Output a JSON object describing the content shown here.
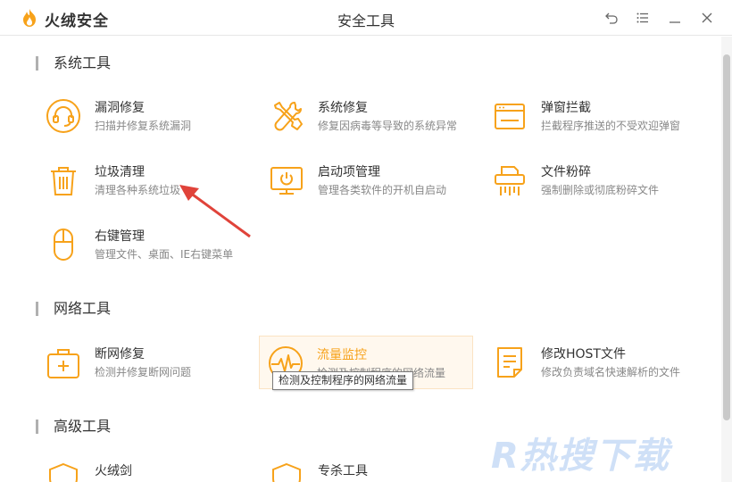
{
  "app": {
    "brand": "火绒安全",
    "window_title": "安全工具",
    "buttons": [
      "back-icon",
      "menu-icon",
      "minimize-icon",
      "close-icon"
    ]
  },
  "colors": {
    "accent": "#f7a21a",
    "text": "#333333",
    "muted": "#888888",
    "arrow": "#e0433a"
  },
  "sections": {
    "system": {
      "title": "系统工具"
    },
    "network": {
      "title": "网络工具"
    },
    "advanced": {
      "title": "高级工具"
    }
  },
  "tools": {
    "vuln_fix": {
      "name": "漏洞修复",
      "desc": "扫描并修复系统漏洞",
      "icon": "headset-icon"
    },
    "system_fix": {
      "name": "系统修复",
      "desc": "修复因病毒等导致的系统异常",
      "icon": "wrench-icon"
    },
    "popup_block": {
      "name": "弹窗拦截",
      "desc": "拦截程序推送的不受欢迎弹窗",
      "icon": "window-icon"
    },
    "junk_clean": {
      "name": "垃圾清理",
      "desc": "清理各种系统垃圾",
      "icon": "trash-icon"
    },
    "startup_mgr": {
      "name": "启动项管理",
      "desc": "管理各类软件的开机自启动",
      "icon": "monitor-icon"
    },
    "file_shred": {
      "name": "文件粉碎",
      "desc": "强制删除或彻底粉碎文件",
      "icon": "shredder-icon"
    },
    "context_menu": {
      "name": "右键管理",
      "desc": "管理文件、桌面、IE右键菜单",
      "icon": "mouse-icon"
    },
    "net_fix": {
      "name": "断网修复",
      "desc": "检测并修复断网问题",
      "icon": "medkit-icon"
    },
    "traffic_monitor": {
      "name": "流量监控",
      "desc": "检测及控制程序的网络流量",
      "icon": "gauge-icon"
    },
    "host_edit": {
      "name": "修改HOST文件",
      "desc": "修改负责域名快速解析的文件",
      "icon": "document-icon"
    },
    "adv_1": {
      "name": "火绒剑",
      "icon": "shield-icon"
    },
    "adv_2": {
      "name": "专杀工具",
      "icon": "shield-icon"
    }
  },
  "tooltip": {
    "text": "检测及控制程序的网络流量"
  },
  "watermark": {
    "text": "R热搜下载"
  }
}
